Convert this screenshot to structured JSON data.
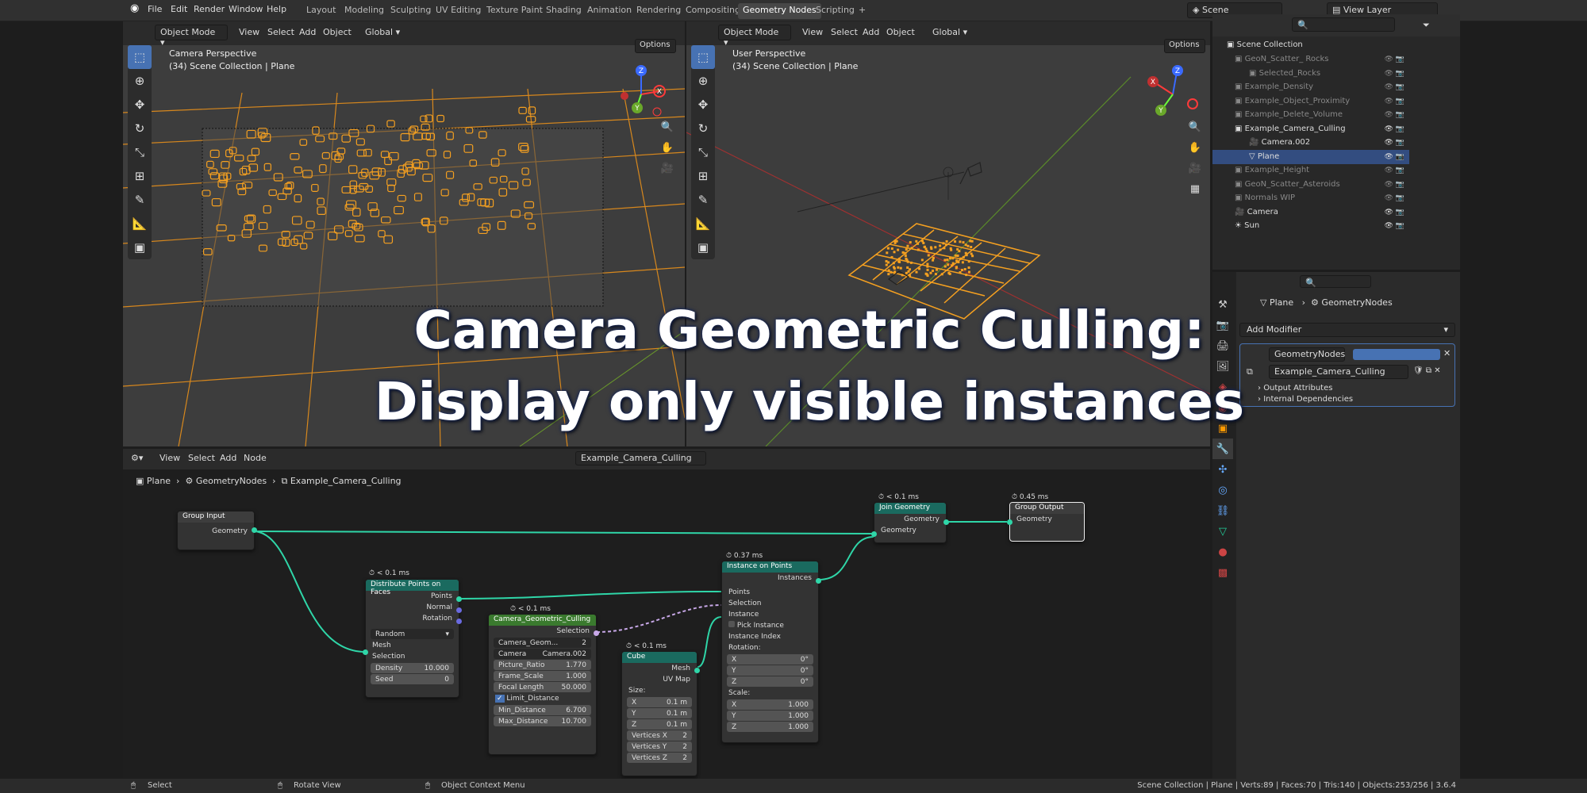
{
  "topbar": {
    "menus": [
      "File",
      "Edit",
      "Render",
      "Window",
      "Help"
    ],
    "workspaces": [
      "Layout",
      "Modeling",
      "Sculpting",
      "UV Editing",
      "Texture Paint",
      "Shading",
      "Animation",
      "Rendering",
      "Compositing",
      "Geometry Nodes",
      "Scripting"
    ],
    "active_workspace": "Geometry Nodes",
    "add_tab": "+",
    "scene": "Scene",
    "view_layer": "View Layer"
  },
  "viewport_left": {
    "mode": "Object Mode",
    "menus": [
      "View",
      "Select",
      "Add",
      "Object"
    ],
    "orientation": "Global",
    "options": "Options",
    "info_line1": "Camera Perspective",
    "info_line2": "(34) Scene Collection | Plane",
    "gizmo": {
      "x": "X",
      "y": "Y",
      "z": "Z"
    }
  },
  "viewport_right": {
    "mode": "Object Mode",
    "menus": [
      "View",
      "Select",
      "Add",
      "Object"
    ],
    "orientation": "Global",
    "options": "Options",
    "info_line1": "User Perspective",
    "info_line2": "(34) Scene Collection | Plane",
    "gizmo": {
      "x": "X",
      "y": "Y",
      "z": "Z"
    }
  },
  "outliner": {
    "root": "Scene Collection",
    "rows": [
      {
        "label": "GeoN_Scatter_ Rocks",
        "dim": true
      },
      {
        "label": "Selected_Rocks",
        "dim": true
      },
      {
        "label": "Example_Density",
        "dim": true
      },
      {
        "label": "Example_Object_Proximity",
        "dim": true
      },
      {
        "label": "Example_Delete_Volume",
        "dim": true
      },
      {
        "label": "Example_Camera_Culling",
        "dim": false
      },
      {
        "label": "Camera.002",
        "dim": false
      },
      {
        "label": "Plane",
        "dim": false,
        "selected": true
      },
      {
        "label": "Example_Height",
        "dim": true
      },
      {
        "label": "GeoN_Scatter_Asteroids",
        "dim": true
      },
      {
        "label": "Normals WIP",
        "dim": true
      },
      {
        "label": "Camera",
        "dim": false
      },
      {
        "label": "Sun",
        "dim": false
      }
    ]
  },
  "properties": {
    "breadcrumb_object": "Plane",
    "breadcrumb_modifier": "GeometryNodes",
    "add_modifier": "Add Modifier",
    "modifier_name": "GeometryNodes",
    "node_group": "Example_Camera_Culling",
    "output_attributes": "Output Attributes",
    "internal_dependencies": "Internal Dependencies"
  },
  "node_editor": {
    "menus": [
      "View",
      "Select",
      "Add",
      "Node"
    ],
    "node_tree": "Example_Camera_Culling",
    "breadcrumb": [
      "Plane",
      "GeometryNodes",
      "Example_Camera_Culling"
    ],
    "nodes": {
      "group_input": {
        "title": "Group Input",
        "geometry": "Geometry"
      },
      "distribute": {
        "timing": "< 0.1 ms",
        "title": "Distribute Points on Faces",
        "points": "Points",
        "normal": "Normal",
        "rotation": "Rotation",
        "method": "Random",
        "mesh": "Mesh",
        "selection": "Selection",
        "density_label": "Density",
        "density": "10.000",
        "seed_label": "Seed",
        "seed": "0"
      },
      "camera_culling": {
        "timing": "< 0.1 ms",
        "title": "Camera_Geometric_Culling",
        "selection": "Selection",
        "group_name": "Camera_Geom...",
        "users": "2",
        "camera_label": "Camera",
        "camera": "Camera.002",
        "picture_ratio_label": "Picture_Ratio",
        "picture_ratio": "1.770",
        "frame_scale_label": "Frame_Scale",
        "frame_scale": "1.000",
        "focal_length_label": "Focal Length",
        "focal_length": "50.000",
        "limit_distance": "Limit_Distance",
        "min_distance_label": "Min_Distance",
        "min_distance": "6.700",
        "max_distance_label": "Max_Distance",
        "max_distance": "10.700"
      },
      "cube": {
        "timing": "< 0.1 ms",
        "title": "Cube",
        "mesh": "Mesh",
        "uvmap": "UV Map",
        "size": "Size:",
        "x_label": "X",
        "x": "0.1 m",
        "y_label": "Y",
        "y": "0.1 m",
        "z_label": "Z",
        "z": "0.1 m",
        "vx_label": "Vertices X",
        "vx": "2",
        "vy_label": "Vertices Y",
        "vy": "2",
        "vz_label": "Vertices Z",
        "vz": "2"
      },
      "instance": {
        "timing": "0.37 ms",
        "title": "Instance on Points",
        "instances": "Instances",
        "points": "Points",
        "selection": "Selection",
        "instance": "Instance",
        "pick": "Pick Instance",
        "index": "Instance Index",
        "rotation": "Rotation:",
        "rx_label": "X",
        "rx": "0°",
        "ry_label": "Y",
        "ry": "0°",
        "rz_label": "Z",
        "rz": "0°",
        "scale": "Scale:",
        "sx_label": "X",
        "sx": "1.000",
        "sy_label": "Y",
        "sy": "1.000",
        "sz_label": "Z",
        "sz": "1.000"
      },
      "join": {
        "timing": "< 0.1 ms",
        "title": "Join Geometry",
        "geometry_out": "Geometry",
        "geometry_in": "Geometry"
      },
      "group_output": {
        "timing": "0.45 ms",
        "title": "Group Output",
        "geometry": "Geometry"
      }
    }
  },
  "overlay": {
    "line1": "Camera Geometric Culling:",
    "line2": "Display only visible instances"
  },
  "statusbar": {
    "select": "Select",
    "rotate": "Rotate View",
    "context": "Object Context Menu",
    "stats": "Scene Collection | Plane | Verts:89 | Faces:70 | Tris:140 | Objects:253/256 | 3.6.4"
  },
  "colors": {
    "accent": "#4772b3",
    "orange": "#f5a020",
    "teal_wire": "#2fd6a8",
    "geo_node_header": "#1a6a5f",
    "bg": "#3d3d3d"
  }
}
